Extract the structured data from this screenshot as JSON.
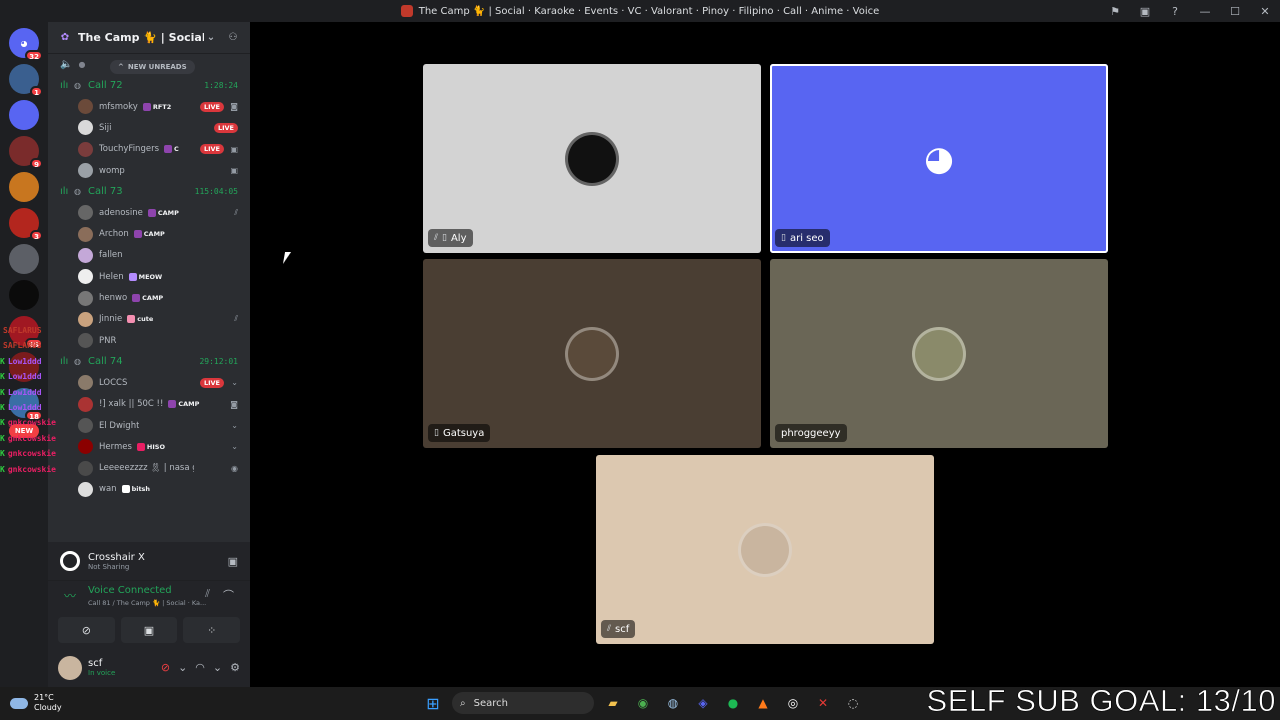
{
  "window": {
    "title": "The Camp 🐈 | Social · Karaoke · Events · VC · Valorant · Pinoy · Filipino · Call · Anime · Voice"
  },
  "servers": [
    {
      "badge": "32",
      "color": "#5865f2",
      "icon": "discord-home-icon"
    },
    {
      "badge": "1",
      "color": "#3a5f8f"
    },
    {
      "badge": "",
      "color": "#5865f2"
    },
    {
      "badge": "9",
      "color": "#7a2b2b"
    },
    {
      "badge": "",
      "color": "#c8761f"
    },
    {
      "badge": "3",
      "color": "#b3261e"
    },
    {
      "badge": "",
      "color": "#5c5f66"
    },
    {
      "badge": "",
      "color": "#0b0b0b"
    },
    {
      "badge": "69",
      "color": "#a01822"
    },
    {
      "badge": "",
      "color": "#7a1c1c"
    },
    {
      "badge": "18",
      "color": "#3a6ea5"
    }
  ],
  "new_pill": "NEW",
  "overlay_chat": [
    {
      "prefix": "",
      "text": "SAFLARUS",
      "color": "#c0392b"
    },
    {
      "prefix": "",
      "text": "SAFLARUS",
      "color": "#c0392b"
    },
    {
      "prefix": "K",
      "text": "Low1ddd",
      "color": "#a855f7"
    },
    {
      "prefix": "K",
      "text": "Low1ddd",
      "color": "#a855f7"
    },
    {
      "prefix": "K",
      "text": "Low1ddd",
      "color": "#a855f7"
    },
    {
      "prefix": "K",
      "text": "Low1ddd",
      "color": "#a855f7"
    },
    {
      "prefix": "K",
      "text": "gnkcowskie",
      "color": "#e91e63"
    },
    {
      "prefix": "K",
      "text": "gnkcowskie",
      "color": "#e91e63"
    },
    {
      "prefix": "K",
      "text": "gnkcowskie",
      "color": "#e91e63"
    },
    {
      "prefix": "K",
      "text": "gnkcowskie",
      "color": "#e91e63"
    }
  ],
  "guild": {
    "name": "The Camp 🐈 | Social · ...",
    "new_unreads": "NEW UNREADS"
  },
  "voice_channels": [
    {
      "name": "Call 72",
      "timer": "1:28:24",
      "users": [
        {
          "name": "mfsmoky",
          "tag": "RFT2",
          "tag_color": "#8e44ad",
          "live": true,
          "icon": "camera",
          "av": "#6b4a3a"
        },
        {
          "name": "Siji",
          "tag": "",
          "live": true,
          "icon": "",
          "av": "#d9d9d9"
        },
        {
          "name": "TouchyFingers",
          "tag": "C",
          "tag_color": "#8e44ad",
          "live": true,
          "icon": "screen",
          "av": "#7a3c3c"
        },
        {
          "name": "womp",
          "tag": "",
          "live": false,
          "icon": "screen",
          "av": "#9aa0a6"
        }
      ]
    },
    {
      "name": "Call 73",
      "timer": "115:04:05",
      "users": [
        {
          "name": "adenosine",
          "tag": "CAMP",
          "tag_color": "#8e44ad",
          "live": false,
          "icon": "mute",
          "av": "#666"
        },
        {
          "name": "Archon",
          "tag": "CAMP",
          "tag_color": "#8e44ad",
          "live": false,
          "icon": "",
          "av": "#8a6d5a"
        },
        {
          "name": "fallen",
          "tag": "",
          "live": false,
          "icon": "",
          "av": "#c4a8d8"
        },
        {
          "name": "Helen",
          "tag": "MEOW",
          "tag_color": "#b48cff",
          "live": false,
          "icon": "",
          "av": "#eeeeee"
        },
        {
          "name": "henwo",
          "tag": "CAMP",
          "tag_color": "#8e44ad",
          "live": false,
          "icon": "",
          "av": "#777"
        },
        {
          "name": "Jinnie",
          "tag": "cute",
          "tag_color": "#f48fb1",
          "live": false,
          "icon": "mute",
          "av": "#c9a27e"
        },
        {
          "name": "PNR",
          "tag": "",
          "live": false,
          "icon": "",
          "av": "#555"
        }
      ]
    },
    {
      "name": "Call 74",
      "timer": "29:12:01",
      "users": [
        {
          "name": "LOCCS",
          "tag": "",
          "live": true,
          "icon": "chev",
          "av": "#8a7a6a"
        },
        {
          "name": "!] xalk || 50C !!",
          "tag": "CAMP",
          "tag_color": "#8e44ad",
          "live": false,
          "icon": "camera",
          "av": "#a33"
        },
        {
          "name": "El Dwight",
          "tag": "",
          "live": false,
          "icon": "chev",
          "av": "#555"
        },
        {
          "name": "Hermes",
          "tag": "HISO",
          "tag_color": "#e91e63",
          "live": false,
          "icon": "chev",
          "av": "#8b0000"
        },
        {
          "name": "Leeeeezzzz 🎗 | nasa gym",
          "tag": "",
          "live": false,
          "icon": "dot",
          "av": "#4a4a4a"
        },
        {
          "name": "wan",
          "tag": "bitsh",
          "tag_color": "#ffffff",
          "live": false,
          "icon": "",
          "av": "#ddd"
        }
      ]
    }
  ],
  "crosshair": {
    "title": "Crosshair X",
    "status": "Not Sharing"
  },
  "voice_status": {
    "label": "Voice Connected",
    "channel": "Call 81 / The Camp 🐈 | Social · Ka..."
  },
  "user": {
    "name": "scf",
    "status": "In voice"
  },
  "tiles": [
    {
      "name": "Aly",
      "bg": "#d3d3d3",
      "icons": [
        "mute",
        "mobile"
      ],
      "speaking": false,
      "av": "#111"
    },
    {
      "name": "ari seo",
      "bg": "#5865f2",
      "icons": [
        "mobile"
      ],
      "speaking": true,
      "av": "discord"
    },
    {
      "name": "Gatsuya",
      "bg": "#4a3e33",
      "icons": [
        "mobile"
      ],
      "speaking": false,
      "av": "#5a4a3a"
    },
    {
      "name": "phroggeeyy",
      "bg": "#6a6656",
      "icons": [],
      "speaking": false,
      "av": "#8a8a6a"
    },
    {
      "name": "scf",
      "bg": "#dcc8b0",
      "icons": [
        "mute"
      ],
      "speaking": false,
      "av": "#c9b59f"
    }
  ],
  "taskbar": {
    "weather_temp": "21°C",
    "weather_desc": "Cloudy",
    "search_label": "Search",
    "sub_goal": "SELF SUB GOAL: 13/10"
  }
}
